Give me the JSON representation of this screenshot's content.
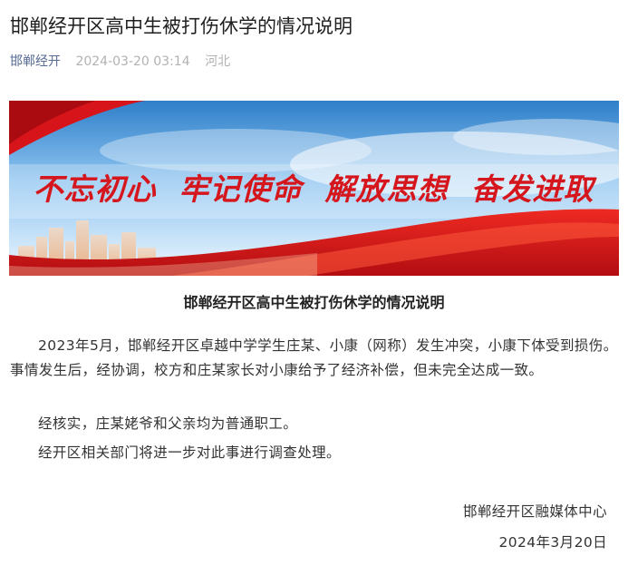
{
  "article": {
    "title": "邯郸经开区高中生被打伤休学的情况说明",
    "account": "邯郸经开",
    "date": "2024-03-20 03:14",
    "region": "河北"
  },
  "banner": {
    "slogan": "不忘初心  牢记使命  解放思想  奋发进取",
    "colors": {
      "sky_top": "#2f7fc9",
      "sky_bottom": "#dcefff",
      "ribbon_red": "#d8141b",
      "text_red": "#d5161c"
    }
  },
  "body": {
    "heading": "邯郸经开区高中生被打伤休学的情况说明",
    "paragraphs": [
      "2023年5月，邯郸经开区卓越中学学生庄某、小康（网称）发生冲突，小康下体受到损伤。事情发生后，经协调，校方和庄某家长对小康给予了经济补偿，但未完全达成一致。",
      "经核实，庄某姥爷和父亲均为普通职工。",
      "经开区相关部门将进一步对此事进行调查处理。"
    ],
    "signature_org": "邯郸经开区融媒体中心",
    "signature_date": "2024年3月20日"
  }
}
